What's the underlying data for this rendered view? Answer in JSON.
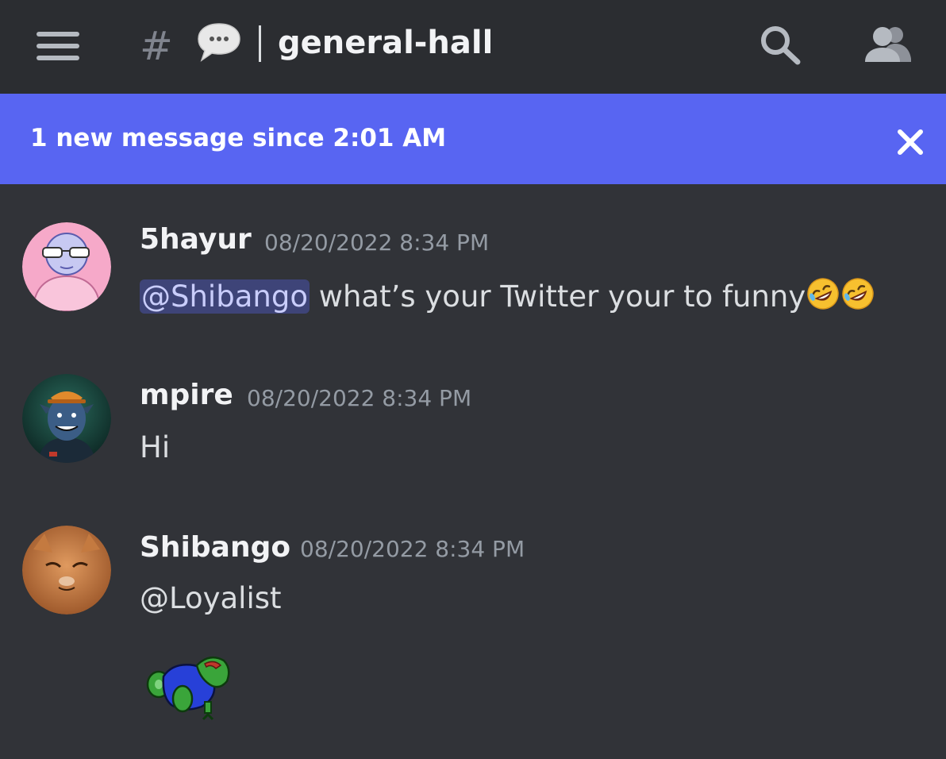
{
  "header": {
    "hash_symbol": "#",
    "channel_name": "general-hall",
    "icons": [
      "menu-icon",
      "speech-bubble-icon",
      "search-icon",
      "members-icon"
    ]
  },
  "banner": {
    "text": "1 new message since 2:01 AM",
    "close_icon": "close-icon"
  },
  "messages": [
    {
      "author": "5hayur",
      "timestamp": "08/20/2022 8:34 PM",
      "mention": "@Shibango",
      "text": " what’s your Twitter your to funny",
      "emojis": [
        "rolling-on-floor-laughing-emoji",
        "rolling-on-floor-laughing-emoji"
      ]
    },
    {
      "author": "mpire",
      "timestamp": "08/20/2022 8:34 PM",
      "text": "Hi"
    },
    {
      "author": "Shibango",
      "timestamp": "08/20/2022 8:34 PM",
      "text": "@Loyalist",
      "sticker": "frog-sticker"
    }
  ],
  "colors": {
    "background": "#313338",
    "header": "#2b2d31",
    "banner": "#5865f2",
    "mention_bg": "#5865f2",
    "timestamp": "#949ba4"
  }
}
